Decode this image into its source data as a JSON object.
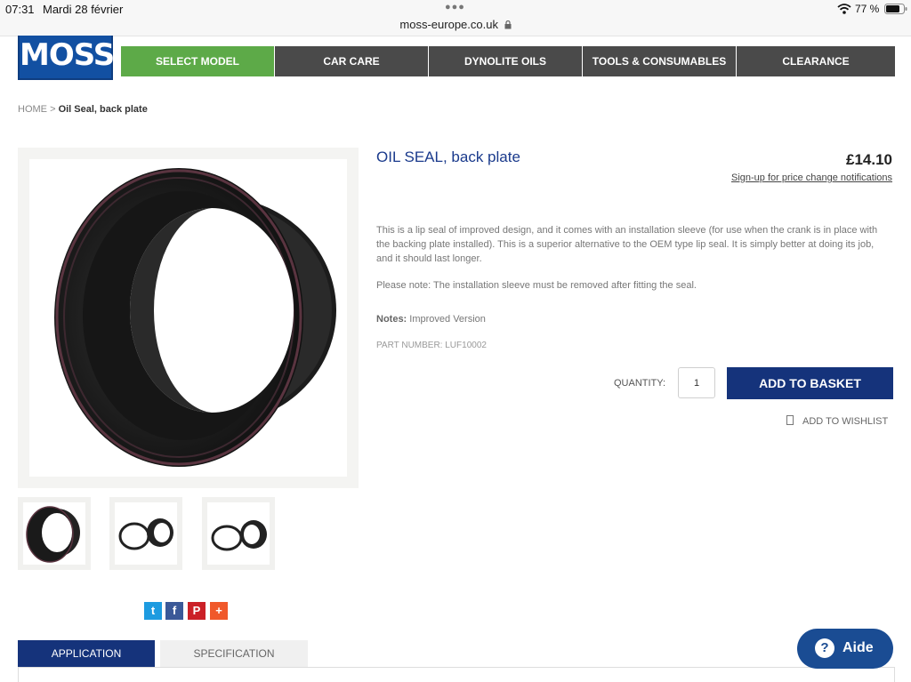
{
  "status_bar": {
    "time": "07:31",
    "date": "Mardi 28 février",
    "url": "moss-europe.co.uk",
    "battery": "77 %"
  },
  "logo": {
    "text": "MOSS"
  },
  "nav": {
    "items": [
      {
        "label": "SELECT MODEL"
      },
      {
        "label": "CAR CARE"
      },
      {
        "label": "DYNOLITE OILS"
      },
      {
        "label": "TOOLS & CONSUMABLES"
      },
      {
        "label": "CLEARANCE"
      }
    ]
  },
  "breadcrumb": {
    "home": "HOME",
    "separator": ">",
    "current": "Oil Seal, back plate"
  },
  "product": {
    "title": "OIL SEAL, back plate",
    "price": "£14.10",
    "signup_link": "Sign-up for price change notifications",
    "description": "This is a lip seal of improved design, and it comes with an installation sleeve (for use when the crank is in place with the backing plate installed). This is a superior alternative to the OEM type lip seal. It is simply better at doing its job, and it should last longer.",
    "note": "Please note: The installation sleeve must be removed after fitting the seal.",
    "notes_label": "Notes:",
    "notes_value": "Improved Version",
    "part_number": "PART NUMBER: LUF10002",
    "quantity_label": "QUANTITY:",
    "quantity_value": "1",
    "add_to_basket": "ADD TO BASKET",
    "add_to_wishlist": "ADD TO WISHLIST"
  },
  "share": {
    "twitter": "t",
    "facebook": "f",
    "pinterest": "P",
    "more": "+"
  },
  "tabs": [
    {
      "label": "APPLICATION"
    },
    {
      "label": "SPECIFICATION"
    }
  ],
  "help": {
    "icon": "?",
    "label": "Aide"
  },
  "colors": {
    "nav_active": "#5daa48",
    "nav": "#4a4a4a",
    "brand_blue": "#15337b",
    "logo_blue": "#1250a2"
  }
}
